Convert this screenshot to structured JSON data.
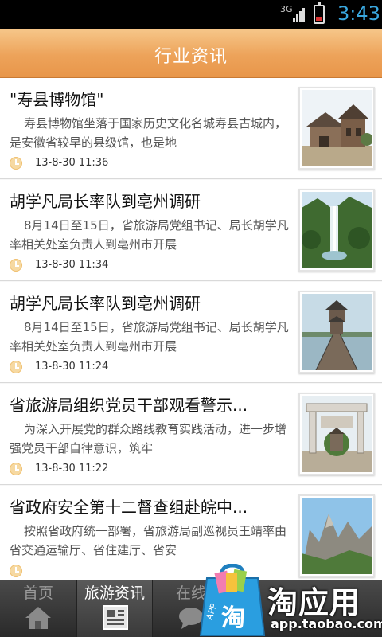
{
  "status_bar": {
    "network": "3G",
    "time": "3:43",
    "battery_color": "#dd3333",
    "time_color": "#3aa8e0"
  },
  "header": {
    "title": "行业资讯",
    "background_color": "#eda35a"
  },
  "articles": [
    {
      "headline": "\"寿县博物馆\"",
      "summary": "寿县博物馆坐落于国家历史文化名城寿县古城内，是安徽省较早的县级馆，也是地",
      "date": "13-8-30 11:36",
      "thumbnail": "museum-building-photo"
    },
    {
      "headline": "胡学凡局长率队到亳州调研",
      "summary": "8月14日至15日，省旅游局党组书记、局长胡学凡率相关处室负责人到亳州市开展",
      "date": "13-8-30 11:34",
      "thumbnail": "waterfall-mountain-photo"
    },
    {
      "headline": "胡学凡局长率队到亳州调研",
      "summary": "8月14日至15日，省旅游局党组书记、局长胡学凡率相关处室负责人到亳州市开展",
      "date": "13-8-30 11:24",
      "thumbnail": "lake-pavilion-bridge-photo"
    },
    {
      "headline": "省旅游局组织党员干部观看警示...",
      "summary": "为深入开展党的群众路线教育实践活动，进一步增强党员干部自律意识，筑牢",
      "date": "13-8-30 11:22",
      "thumbnail": "memorial-archway-photo"
    },
    {
      "headline": "省政府安全第十二督查组赴皖中...",
      "summary": "按照省政府统一部署，省旅游局副巡视员王靖率由省交通运输厅、省住建厅、省安",
      "date": "",
      "thumbnail": "mountain-peaks-photo"
    }
  ],
  "tabs": [
    {
      "label": "首页",
      "icon": "home-icon",
      "active": false
    },
    {
      "label": "旅游资讯",
      "icon": "newspaper-icon",
      "active": true
    },
    {
      "label": "在线",
      "icon": "chat-bubble-icon",
      "active": false
    }
  ],
  "watermark": {
    "brand": "淘应用",
    "url": "app.taobao.com",
    "bag_label": "APP",
    "bag_char": "淘",
    "bag_color": "#2a9ee0"
  }
}
